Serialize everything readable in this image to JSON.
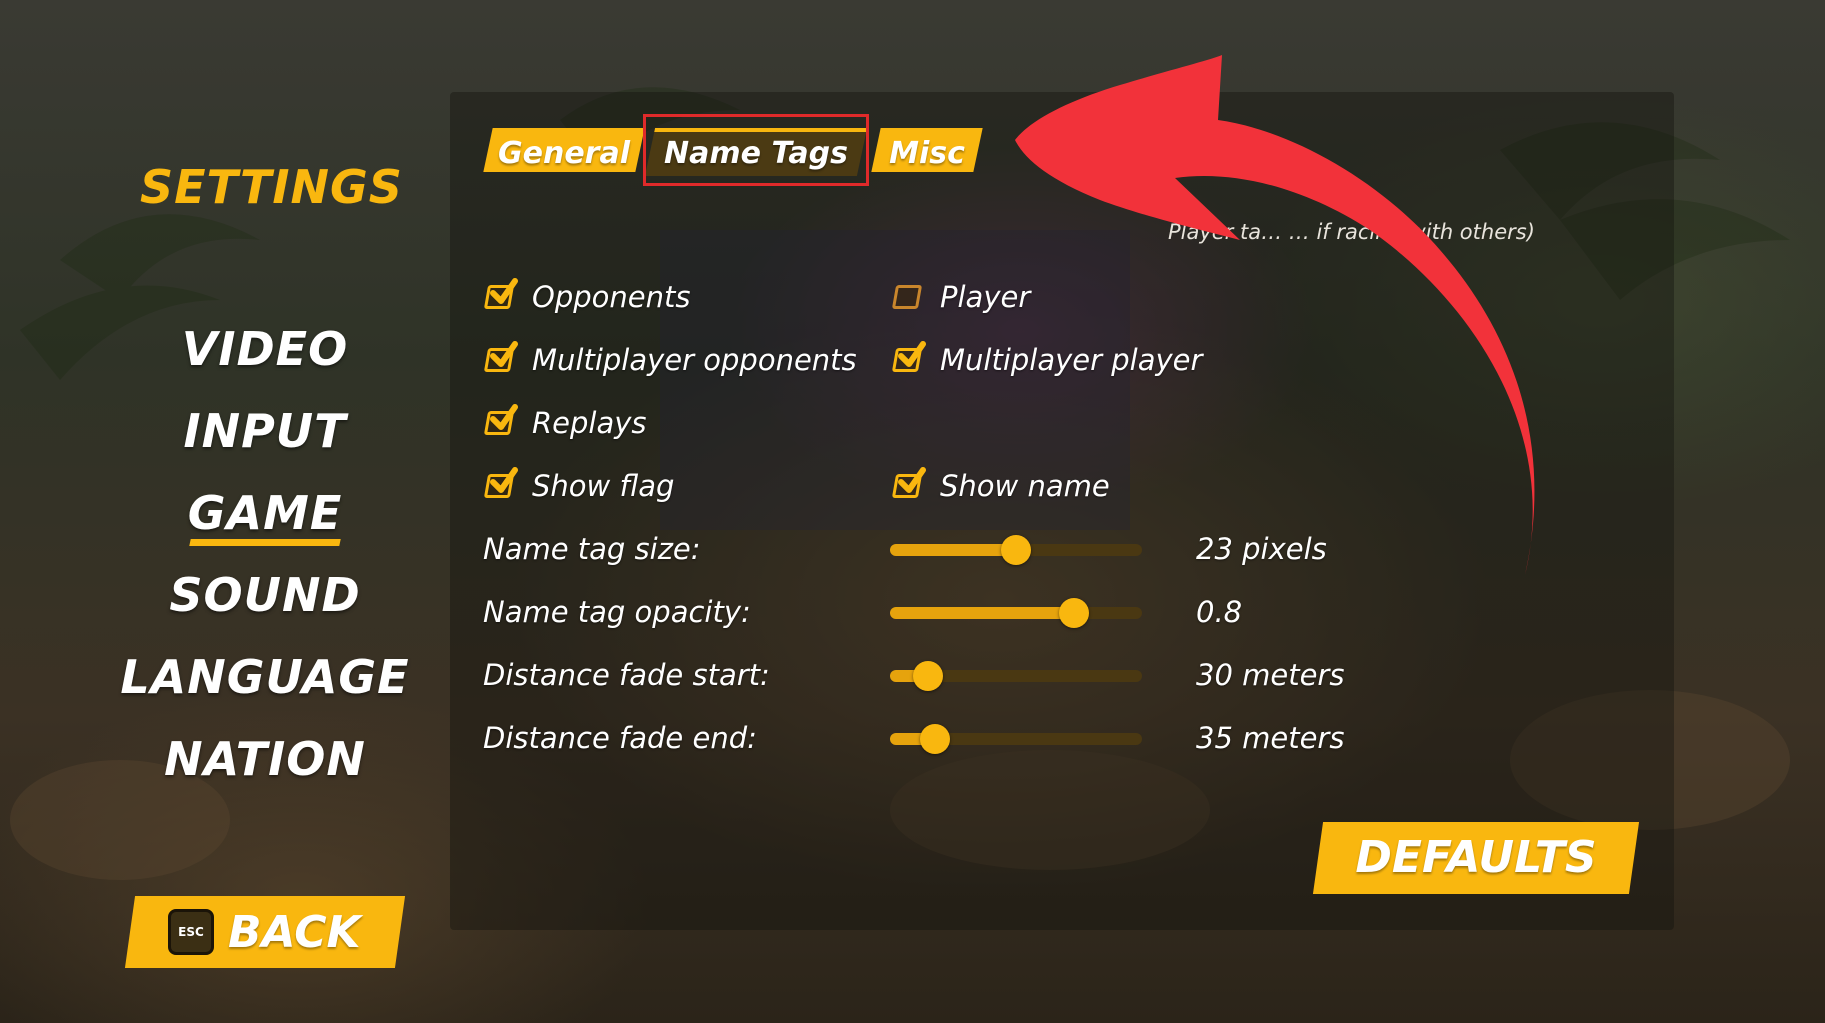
{
  "menu": {
    "title": "SETTINGS",
    "items": [
      {
        "label": "VIDEO",
        "active": false
      },
      {
        "label": "INPUT",
        "active": false
      },
      {
        "label": "GAME",
        "active": true
      },
      {
        "label": "SOUND",
        "active": false
      },
      {
        "label": "LANGUAGE",
        "active": false
      },
      {
        "label": "NATION",
        "active": false
      }
    ],
    "back_label": "BACK",
    "back_key": "ESC"
  },
  "tabs": [
    {
      "label": "General",
      "active": false
    },
    {
      "label": "Name Tags",
      "active": true
    },
    {
      "label": "Misc",
      "active": false
    }
  ],
  "hint_visible_fragments": "Player ta… … if racing with others)",
  "options": {
    "opponents": {
      "label": "Opponents",
      "checked": true
    },
    "player": {
      "label": "Player",
      "checked": false
    },
    "multiplayer_opponents": {
      "label": "Multiplayer opponents",
      "checked": true
    },
    "multiplayer_player": {
      "label": "Multiplayer player",
      "checked": true
    },
    "replays": {
      "label": "Replays",
      "checked": true
    },
    "show_flag": {
      "label": "Show flag",
      "checked": true
    },
    "show_name": {
      "label": "Show name",
      "checked": true
    }
  },
  "sliders": [
    {
      "label": "Name tag size:",
      "value_text": "23 pixels",
      "level": 0.5
    },
    {
      "label": "Name tag opacity:",
      "value_text": "0.8",
      "level": 0.73
    },
    {
      "label": "Distance fade start:",
      "value_text": "30 meters",
      "level": 0.15
    },
    {
      "label": "Distance fade end:",
      "value_text": "35 meters",
      "level": 0.18
    }
  ],
  "defaults_label": "DEFAULTS",
  "colors": {
    "accent": "#f9b70f",
    "highlight_box": "#e02a2a",
    "arrow": "#f2323a"
  },
  "annotation": {
    "arrow_icon": "curved-arrow-icon",
    "points_to": "Name Tags"
  }
}
